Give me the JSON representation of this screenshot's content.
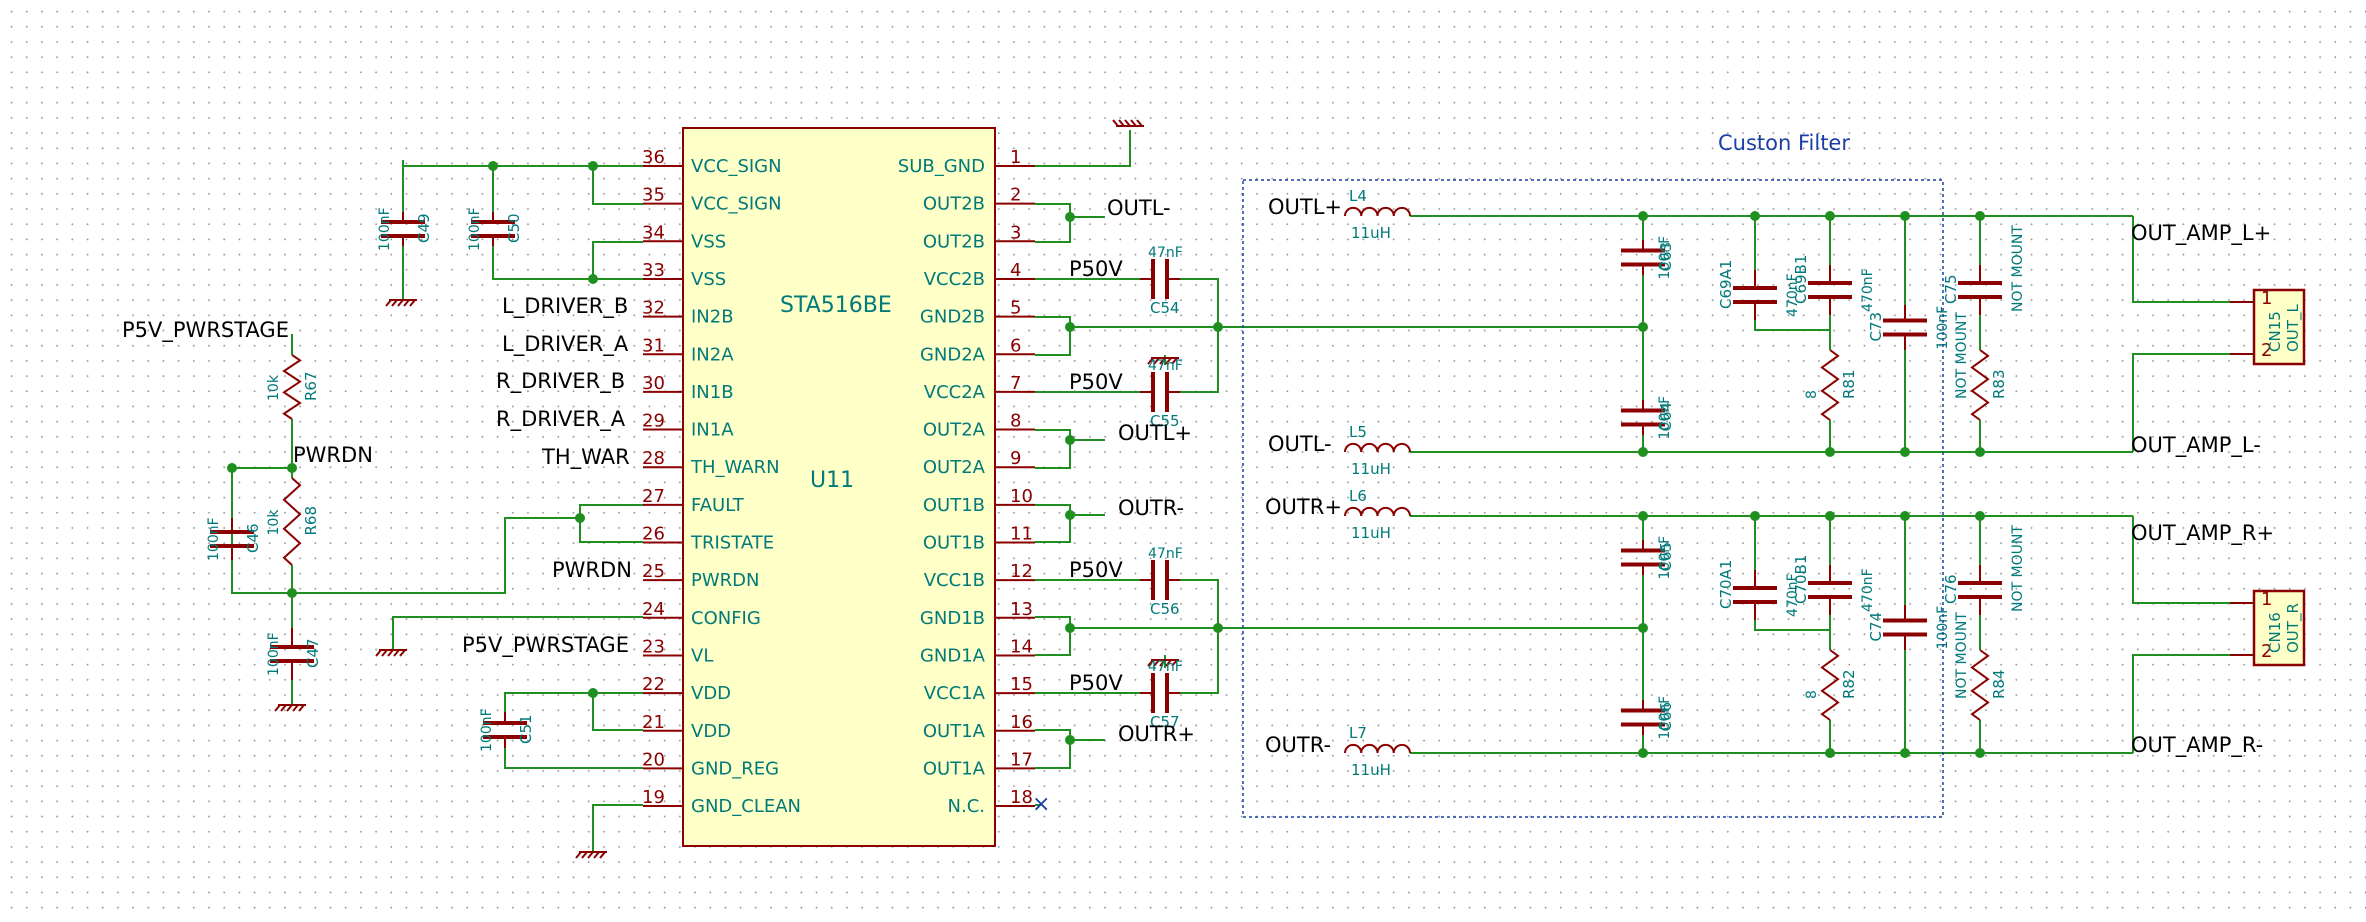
{
  "chip": {
    "name": "STA516BE",
    "ref": "U11",
    "left_pins": [
      {
        "n": "36",
        "name": "VCC_SIGN"
      },
      {
        "n": "35",
        "name": "VCC_SIGN"
      },
      {
        "n": "34",
        "name": "VSS"
      },
      {
        "n": "33",
        "name": "VSS"
      },
      {
        "n": "32",
        "name": "IN2B"
      },
      {
        "n": "31",
        "name": "IN2A"
      },
      {
        "n": "30",
        "name": "IN1B"
      },
      {
        "n": "29",
        "name": "IN1A"
      },
      {
        "n": "28",
        "name": "TH_WARN"
      },
      {
        "n": "27",
        "name": "FAULT"
      },
      {
        "n": "26",
        "name": "TRISTATE"
      },
      {
        "n": "25",
        "name": "PWRDN"
      },
      {
        "n": "24",
        "name": "CONFIG"
      },
      {
        "n": "23",
        "name": "VL"
      },
      {
        "n": "22",
        "name": "VDD"
      },
      {
        "n": "21",
        "name": "VDD"
      },
      {
        "n": "20",
        "name": "GND_REG"
      },
      {
        "n": "19",
        "name": "GND_CLEAN"
      }
    ],
    "right_pins": [
      {
        "n": "1",
        "name": "SUB_GND"
      },
      {
        "n": "2",
        "name": "OUT2B"
      },
      {
        "n": "3",
        "name": "OUT2B"
      },
      {
        "n": "4",
        "name": "VCC2B"
      },
      {
        "n": "5",
        "name": "GND2B"
      },
      {
        "n": "6",
        "name": "GND2A"
      },
      {
        "n": "7",
        "name": "VCC2A"
      },
      {
        "n": "8",
        "name": "OUT2A"
      },
      {
        "n": "9",
        "name": "OUT2A"
      },
      {
        "n": "10",
        "name": "OUT1B"
      },
      {
        "n": "11",
        "name": "OUT1B"
      },
      {
        "n": "12",
        "name": "VCC1B"
      },
      {
        "n": "13",
        "name": "GND1B"
      },
      {
        "n": "14",
        "name": "GND1A"
      },
      {
        "n": "15",
        "name": "VCC1A"
      },
      {
        "n": "16",
        "name": "OUT1A"
      },
      {
        "n": "17",
        "name": "OUT1A"
      },
      {
        "n": "18",
        "name": "N.C."
      }
    ]
  },
  "left_nets": {
    "l_driver_b": "L_DRIVER_B",
    "l_driver_a": "L_DRIVER_A",
    "r_driver_b": "R_DRIVER_B",
    "r_driver_a": "R_DRIVER_A",
    "th_war": "TH_WAR",
    "pwrdn": "PWRDN",
    "p5v": "P5V_PWRSTAGE"
  },
  "right_nets": {
    "outl_minus": "OUTL-",
    "outl_plus": "OUTL+",
    "outr_minus": "OUTR-",
    "outr_plus": "OUTR+",
    "p50v": "P50V"
  },
  "left_parts": {
    "r67": {
      "ref": "R67",
      "val": "10k"
    },
    "r68": {
      "ref": "R68",
      "val": "10k"
    },
    "c46": {
      "ref": "C46",
      "val": "100nF"
    },
    "c47": {
      "ref": "C47",
      "val": "100nF"
    },
    "c49": {
      "ref": "C49",
      "val": "100nF"
    },
    "c50": {
      "ref": "C50",
      "val": "100nF"
    },
    "c51": {
      "ref": "C51",
      "val": "100nF"
    },
    "pwrdn_net": "PWRDN",
    "p5v_net": "P5V_PWRSTAGE"
  },
  "decoupling": {
    "c54": {
      "ref": "C54",
      "val": "47nF"
    },
    "c55": {
      "ref": "C55",
      "val": "47nF"
    },
    "c56": {
      "ref": "C56",
      "val": "47nF"
    },
    "c57": {
      "ref": "C57",
      "val": "47nF"
    }
  },
  "filter": {
    "title": "Custon Filter",
    "inductors": [
      {
        "ref": "L4",
        "val": "11uH",
        "net": "OUTL+"
      },
      {
        "ref": "L5",
        "val": "11uH",
        "net": "OUTL-"
      },
      {
        "ref": "L6",
        "val": "11uH",
        "net": "OUTR+"
      },
      {
        "ref": "L7",
        "val": "11uH",
        "net": "OUTR-"
      }
    ],
    "caps": {
      "c63": {
        "ref": "C63",
        "val": "100nF"
      },
      "c64": {
        "ref": "C64",
        "val": "100nF"
      },
      "c65": {
        "ref": "C65",
        "val": "100nF"
      },
      "c66": {
        "ref": "C66",
        "val": "100nF"
      },
      "c69a1": {
        "ref": "C69A1",
        "val": "470nF"
      },
      "c69b1": {
        "ref": "C69B1",
        "val": "470nF"
      },
      "c70a1": {
        "ref": "C70A1",
        "val": "470nF"
      },
      "c70b1": {
        "ref": "C70B1",
        "val": "470nF"
      },
      "c73": {
        "ref": "C73",
        "val": "100nF"
      },
      "c74": {
        "ref": "C74",
        "val": "100nF"
      },
      "c75": {
        "ref": "C75",
        "val": "NOT MOUNT"
      },
      "c76": {
        "ref": "C76",
        "val": "NOT MOUNT"
      }
    },
    "resistors": {
      "r81": {
        "ref": "R81",
        "val": "8"
      },
      "r82": {
        "ref": "R82",
        "val": "8"
      },
      "r83": {
        "ref": "R83",
        "val": "NOT MOUNT"
      },
      "r84": {
        "ref": "R84",
        "val": "NOT MOUNT"
      }
    }
  },
  "outputs": {
    "out_amp_l_plus": "OUT_AMP_L+",
    "out_amp_l_minus": "OUT_AMP_L-",
    "out_amp_r_plus": "OUT_AMP_R+",
    "out_amp_r_minus": "OUT_AMP_R-"
  },
  "connectors": [
    {
      "ref": "CN15",
      "val": "OUT_L",
      "pin1": "1",
      "pin2": "2"
    },
    {
      "ref": "CN16",
      "val": "OUT_R",
      "pin1": "1",
      "pin2": "2"
    }
  ],
  "nc_mark": "×"
}
